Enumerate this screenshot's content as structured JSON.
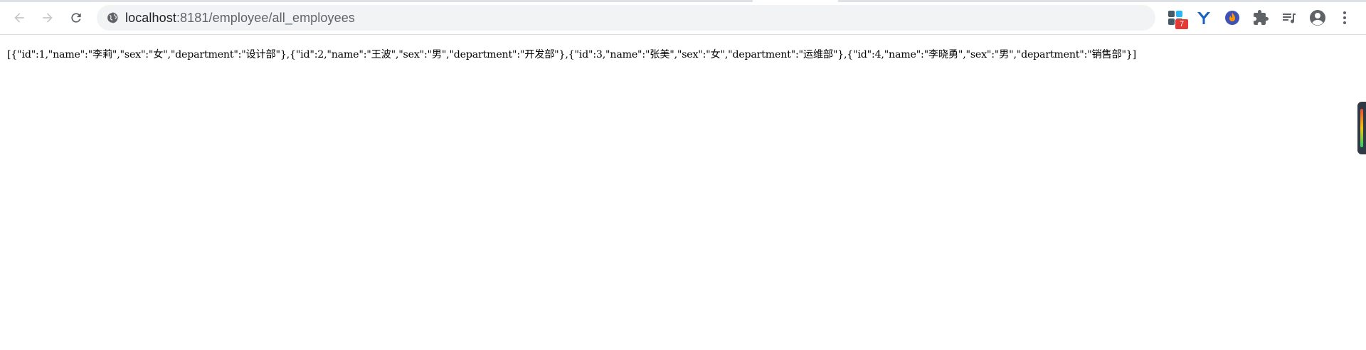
{
  "browser": {
    "url_host": "localhost",
    "url_rest": ":8181/employee/all_employees",
    "extensions": [
      {
        "name": "grid-extension",
        "badge": "7",
        "color": "#1e88e5"
      },
      {
        "name": "y-extension",
        "color": "#1565c0"
      },
      {
        "name": "flame-extension",
        "color": "#3f51b5"
      },
      {
        "name": "puzzle-extension",
        "color": "#5f6368"
      },
      {
        "name": "reading-list",
        "color": "#5f6368"
      },
      {
        "name": "profile",
        "color": "#5f6368"
      }
    ]
  },
  "page": {
    "json_text": "[{\"id\":1,\"name\":\"李莉\",\"sex\":\"女\",\"department\":\"设计部\"},{\"id\":2,\"name\":\"王波\",\"sex\":\"男\",\"department\":\"开发部\"},{\"id\":3,\"name\":\"张美\",\"sex\":\"女\",\"department\":\"运维部\"},{\"id\":4,\"name\":\"李晓勇\",\"sex\":\"男\",\"department\":\"销售部\"}]"
  }
}
